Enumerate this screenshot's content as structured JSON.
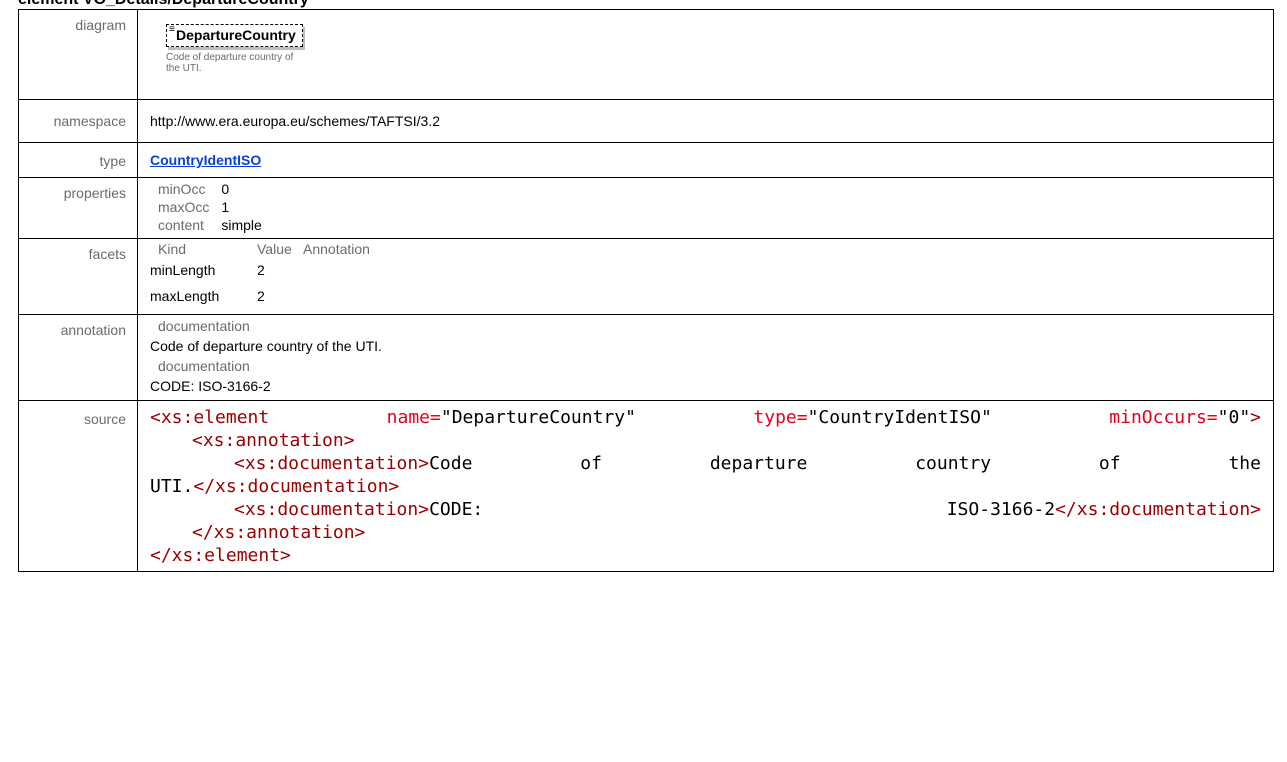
{
  "heading": "element VO_Details/DepartureCountry",
  "labels": {
    "diagram": "diagram",
    "namespace": "namespace",
    "type": "type",
    "properties": "properties",
    "facets": "facets",
    "annotation": "annotation",
    "source": "source"
  },
  "diagram": {
    "icon": "list-icon",
    "element_name": "DepartureCountry",
    "note": "Code of departure country of the UTI."
  },
  "namespace": "http://www.era.europa.eu/schemes/TAFTSI/3.2",
  "type": "CountryIdentISO",
  "properties": [
    {
      "key": "minOcc",
      "value": "0"
    },
    {
      "key": "maxOcc",
      "value": "1"
    },
    {
      "key": "content",
      "value": "simple"
    }
  ],
  "facets": {
    "headers": [
      "Kind",
      "Value",
      "Annotation"
    ],
    "rows": [
      {
        "kind": "minLength",
        "value": "2",
        "annotation": ""
      },
      {
        "kind": "maxLength",
        "value": "2",
        "annotation": ""
      }
    ]
  },
  "annotation": [
    {
      "label": "documentation",
      "text": "Code of departure country of the UTI."
    },
    {
      "label": "documentation",
      "text": "CODE: ISO-3166-2"
    }
  ],
  "source": {
    "l1_tag": "<xs:element",
    "l1_attr1": "name=",
    "l1_val1": "\"DepartureCountry\"",
    "l1_attr2": "type=",
    "l1_val2": "\"CountryIdentISO\"",
    "l1_attr3": "minOccurs=",
    "l1_val3": "\"0\"",
    "l1_close": ">",
    "l2": "<xs:annotation>",
    "l3_tag": "<xs:documentation>",
    "l3_words": [
      "Code",
      "of",
      "departure",
      "country",
      "of",
      "the"
    ],
    "l4_text": "UTI.",
    "l4_close": "</xs:documentation>",
    "l5_tag": "<xs:documentation>",
    "l5_text1": "CODE:",
    "l5_text2": "ISO-3166-2",
    "l5_close": "</xs:documentation>",
    "l6": "</xs:annotation>",
    "l7": "</xs:element>"
  },
  "colors": {
    "label_gray": "#6b6b6b",
    "link_blue": "#0b3fd6",
    "xml_tag": "#990000",
    "xml_attr": "#e3001b"
  }
}
